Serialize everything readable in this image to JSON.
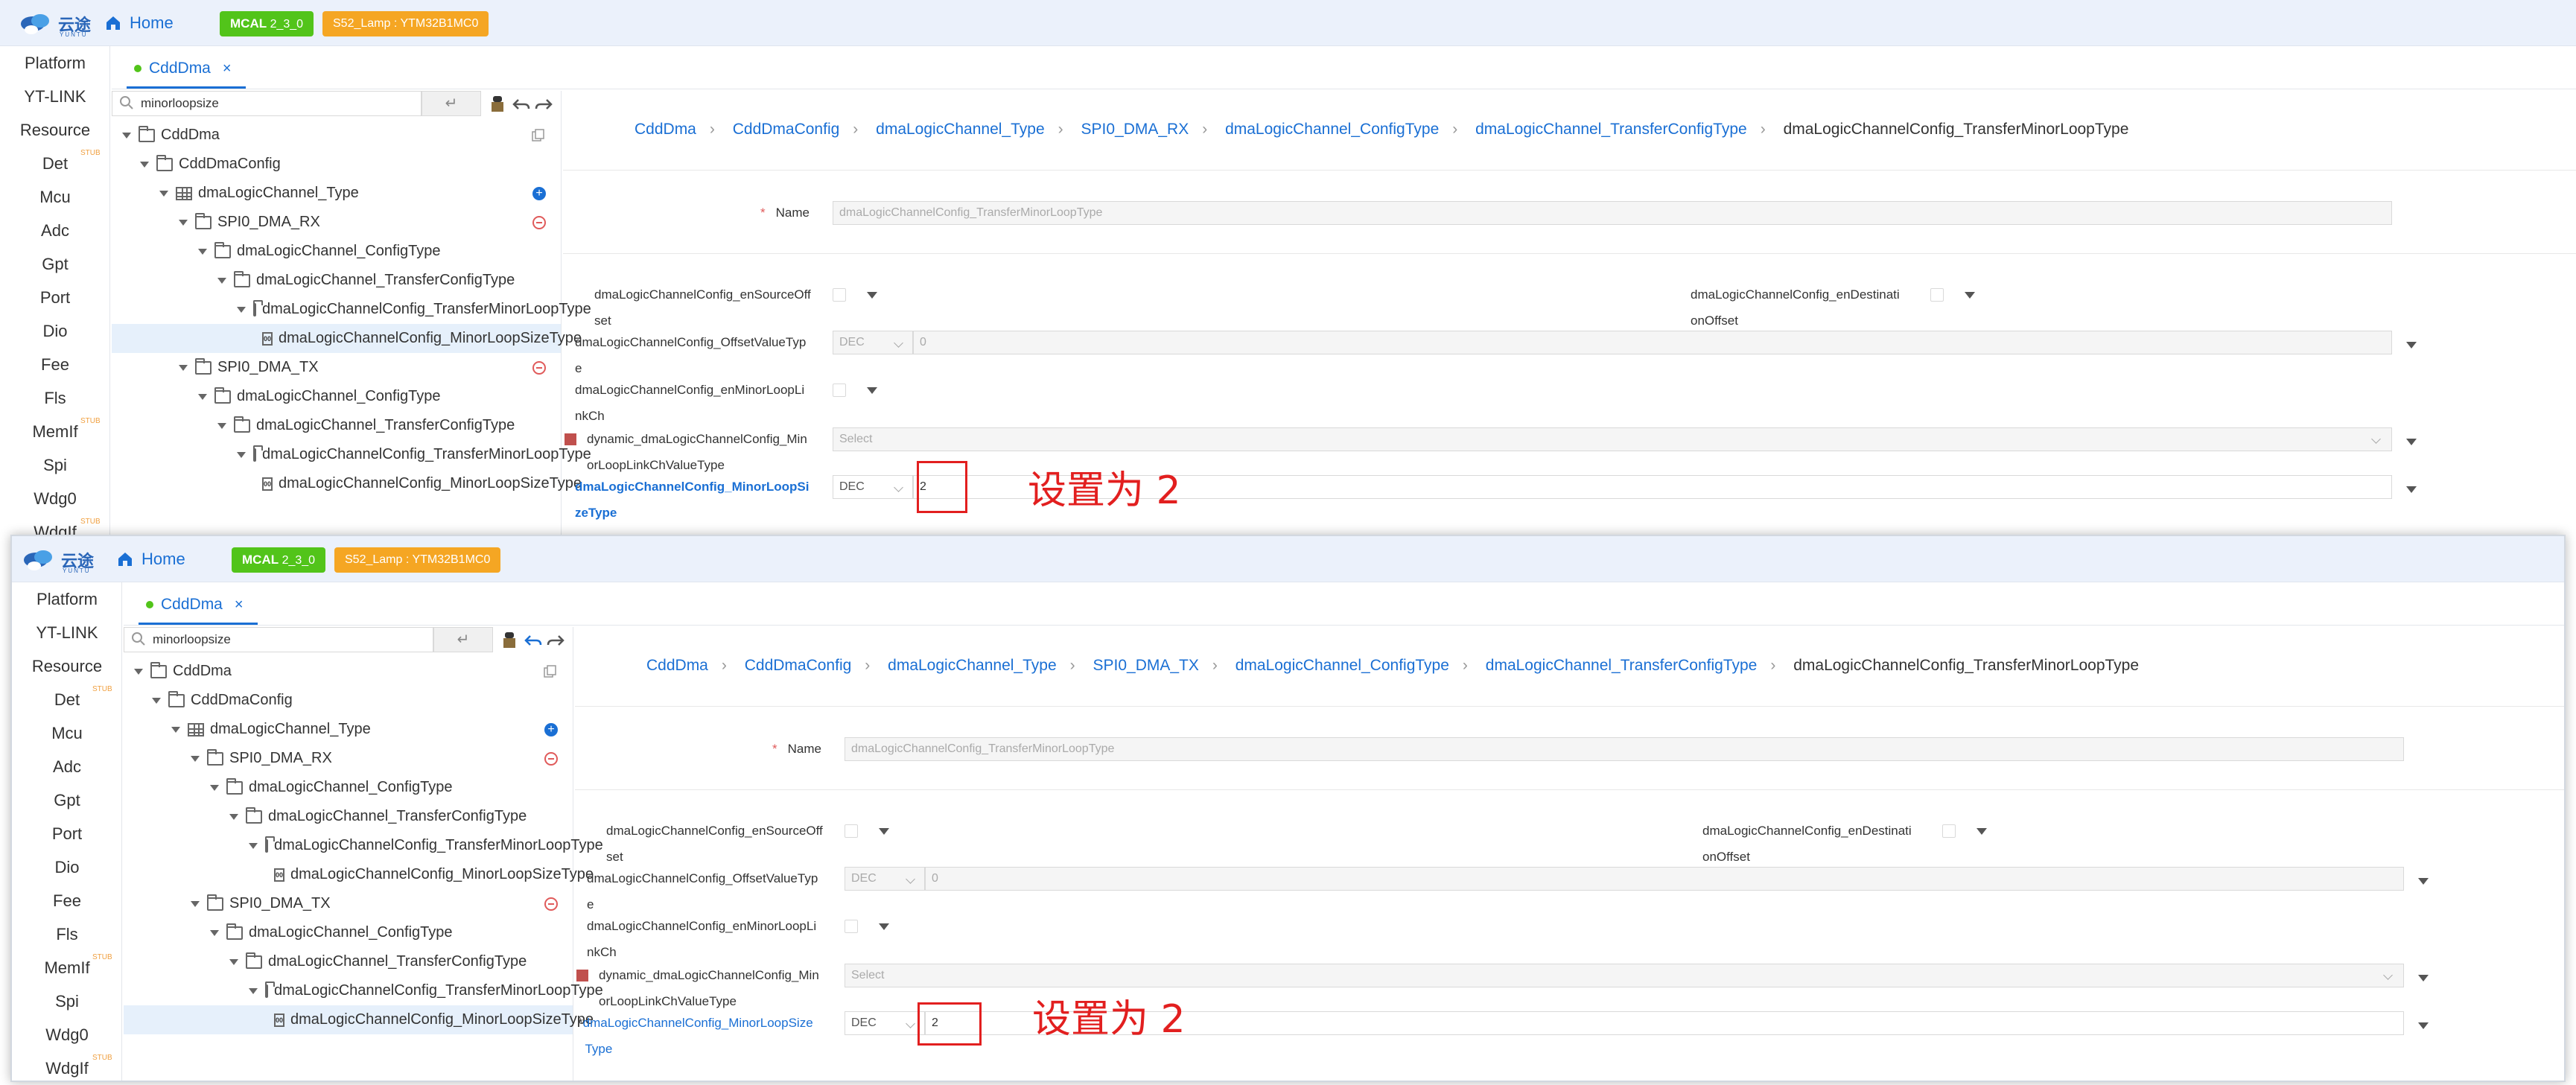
{
  "app": {
    "logo_text": "云途",
    "logo_sub": "YUNTU",
    "home_label": "Home",
    "tag_mcal": "MCAL",
    "tag_mcal_version": "2_3_0",
    "tag_project": "S52_Lamp : YTM32B1MC0",
    "accent": "#1a6fd4",
    "tag_green": "#52c41a",
    "tag_orange": "#f5a623",
    "annotation_color": "#e21f1f"
  },
  "nav": {
    "items": [
      "Platform",
      "YT-LINK",
      "Resource",
      "Det",
      "Mcu",
      "Adc",
      "Gpt",
      "Port",
      "Dio",
      "Fee",
      "Fls",
      "MemIf",
      "Spi",
      "Wdg0",
      "WdgIf"
    ],
    "stub_label": "STUB"
  },
  "tab": {
    "label": "CddDma",
    "close": "×"
  },
  "tree": {
    "search_value": "minorloopsize",
    "enter_glyph": "↵",
    "nodes": [
      "CddDma",
      "CddDmaConfig",
      "dmaLogicChannel_Type",
      "SPI0_DMA_RX",
      "dmaLogicChannel_ConfigType",
      "dmaLogicChannel_TransferConfigType",
      "dmaLogicChannelConfig_TransferMinorLoopType",
      "dmaLogicChannelConfig_MinorLoopSizeType",
      "SPI0_DMA_TX",
      "dmaLogicChannel_ConfigType",
      "dmaLogicChannel_TransferConfigType",
      "dmaLogicChannelConfig_TransferMinorLoopType",
      "dmaLogicChannelConfig_MinorLoopSizeType"
    ]
  },
  "breadcrumb": {
    "top": [
      "CddDma",
      "CddDmaConfig",
      "dmaLogicChannel_Type",
      "SPI0_DMA_RX",
      "dmaLogicChannel_ConfigType",
      "dmaLogicChannel_TransferConfigType",
      "dmaLogicChannelConfig_TransferMinorLoopType"
    ],
    "bottom": [
      "CddDma",
      "CddDmaConfig",
      "dmaLogicChannel_Type",
      "SPI0_DMA_TX",
      "dmaLogicChannel_ConfigType",
      "dmaLogicChannel_TransferConfigType",
      "dmaLogicChannelConfig_TransferMinorLoopType"
    ]
  },
  "form": {
    "name_required": "*",
    "name_label": "Name",
    "name_value": "dmaLogicChannelConfig_TransferMinorLoopType",
    "enSourceOffset_l1": "dmaLogicChannelConfig_enSourceOff",
    "enSourceOffset_l2": "set",
    "enDestOffset_l1": "dmaLogicChannelConfig_enDestinati",
    "enDestOffset_l2": "onOffset",
    "offsetValueType_l1": "dmaLogicChannelConfig_OffsetValueTyp",
    "offsetValueType_l2": "e",
    "offset_format": "DEC",
    "offset_value": "0",
    "enMinorLoopLink_l1": "dmaLogicChannelConfig_enMinorLoopLi",
    "enMinorLoopLink_l2": "nkCh",
    "dynamic_l1": "dynamic_dmaLogicChannelConfig_Min",
    "dynamic_l2": "orLoopLinkChValueType",
    "dynamic_placeholder": "Select",
    "minorLoopSize_l1_top": "dmaLogicChannelConfig_MinorLoopSi",
    "minorLoopSize_l2_top": "zeType",
    "minorLoopSize_l1_bottom": "dmaLogicChannelConfig_MinorLoopSize",
    "minorLoopSize_l2_bottom": "Type",
    "minorLoopSize_required": "*",
    "minorLoopSize_format": "DEC",
    "minorLoopSize_value": "2"
  },
  "annotation": {
    "text": "设置为 2"
  }
}
